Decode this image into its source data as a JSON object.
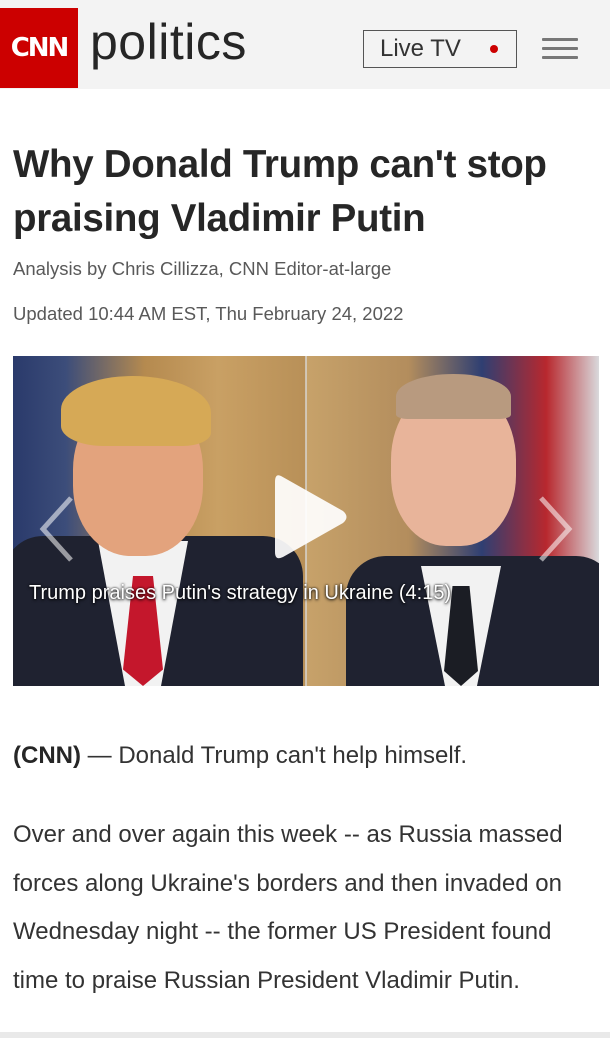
{
  "header": {
    "logo_text": "CNN",
    "section_name": "politics",
    "live_tv_label": "Live TV",
    "brand_color": "#cc0000"
  },
  "article": {
    "headline": "Why Donald Trump can't stop praising Vladimir Putin",
    "byline": "Analysis by Chris Cillizza, CNN Editor-at-large",
    "updated": "Updated 10:44 AM EST, Thu February 24, 2022",
    "video_caption": "Trump praises Putin's strategy in Ukraine (4:15)",
    "lead_source": "(CNN)",
    "lead_text": " — Donald Trump can't help himself.",
    "paragraph": "Over and over again this week -- as Russia massed forces along Ukraine's borders and then invaded on Wednesday night -- the former US President found time to praise Russian President Vladimir Putin."
  },
  "icons": [
    "menu-icon",
    "play-icon",
    "chevron-left-icon",
    "chevron-right-icon"
  ]
}
